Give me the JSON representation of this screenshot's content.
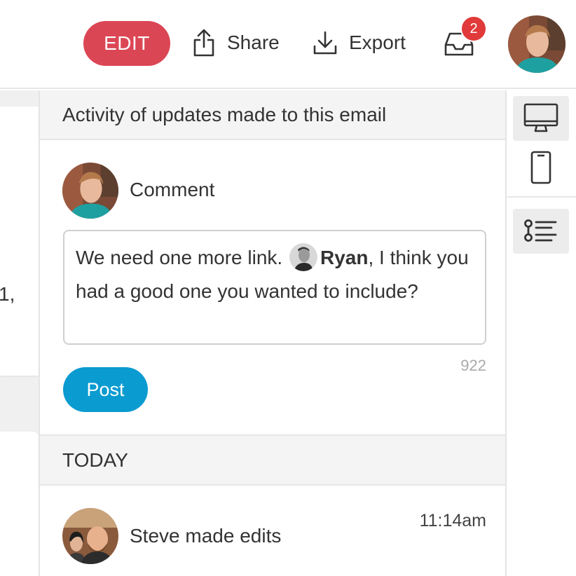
{
  "toolbar": {
    "edit_label": "EDIT",
    "share_label": "Share",
    "export_label": "Export",
    "inbox_count": "2",
    "edit_color": "#db4655",
    "badge_color": "#e03a3a"
  },
  "left_fragment": "1,",
  "activity": {
    "header": "Activity of updates made to this email",
    "comment_label": "Comment",
    "comment_text_before": "We need one more link.",
    "mention_name": "Ryan",
    "comment_text_after": ", I think you had a good one you wanted to include?",
    "char_count": "922",
    "post_label": "Post",
    "post_color": "#0a9bd0",
    "section_today": "TODAY",
    "entries": [
      {
        "text": "Steve made edits",
        "time": "11:14am"
      }
    ]
  },
  "rail": {
    "icons": [
      "desktop-icon",
      "mobile-icon",
      "outline-list-icon"
    ]
  }
}
